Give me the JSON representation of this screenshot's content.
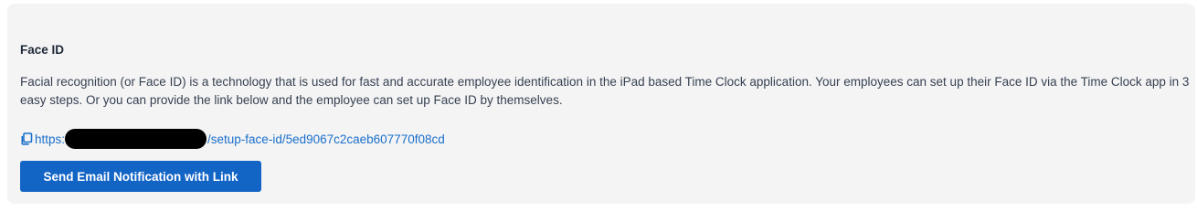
{
  "section": {
    "title": "Face ID",
    "description": "Facial recognition (or Face ID) is a technology that is used for fast and accurate employee identification in the iPad based Time Clock application. Your employees can set up their Face ID via the Time Clock app in 3 easy steps. Or you can provide the link below and the employee can set up Face ID by themselves."
  },
  "link": {
    "icon": "copy-icon",
    "prefix": "https:",
    "suffix": "/setup-face-id/5ed9067c2caeb607770f08cd",
    "color": "#1a6fc9"
  },
  "actions": {
    "send_label": "Send Email Notification with Link",
    "button_color": "#1264c5"
  }
}
